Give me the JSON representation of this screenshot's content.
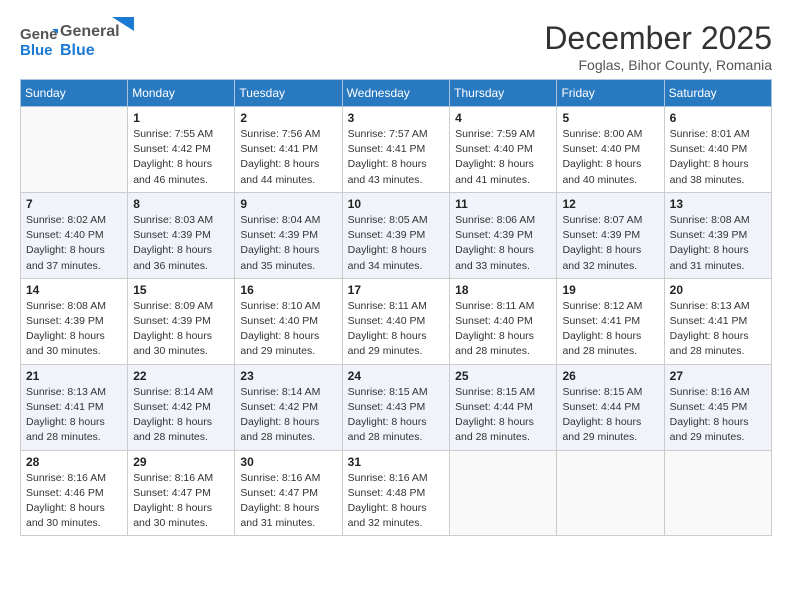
{
  "header": {
    "logo_general": "General",
    "logo_blue": "Blue",
    "month_title": "December 2025",
    "location": "Foglas, Bihor County, Romania"
  },
  "days_of_week": [
    "Sunday",
    "Monday",
    "Tuesday",
    "Wednesday",
    "Thursday",
    "Friday",
    "Saturday"
  ],
  "weeks": [
    [
      {
        "day": "",
        "info": ""
      },
      {
        "day": "1",
        "info": "Sunrise: 7:55 AM\nSunset: 4:42 PM\nDaylight: 8 hours\nand 46 minutes."
      },
      {
        "day": "2",
        "info": "Sunrise: 7:56 AM\nSunset: 4:41 PM\nDaylight: 8 hours\nand 44 minutes."
      },
      {
        "day": "3",
        "info": "Sunrise: 7:57 AM\nSunset: 4:41 PM\nDaylight: 8 hours\nand 43 minutes."
      },
      {
        "day": "4",
        "info": "Sunrise: 7:59 AM\nSunset: 4:40 PM\nDaylight: 8 hours\nand 41 minutes."
      },
      {
        "day": "5",
        "info": "Sunrise: 8:00 AM\nSunset: 4:40 PM\nDaylight: 8 hours\nand 40 minutes."
      },
      {
        "day": "6",
        "info": "Sunrise: 8:01 AM\nSunset: 4:40 PM\nDaylight: 8 hours\nand 38 minutes."
      }
    ],
    [
      {
        "day": "7",
        "info": "Sunrise: 8:02 AM\nSunset: 4:40 PM\nDaylight: 8 hours\nand 37 minutes."
      },
      {
        "day": "8",
        "info": "Sunrise: 8:03 AM\nSunset: 4:39 PM\nDaylight: 8 hours\nand 36 minutes."
      },
      {
        "day": "9",
        "info": "Sunrise: 8:04 AM\nSunset: 4:39 PM\nDaylight: 8 hours\nand 35 minutes."
      },
      {
        "day": "10",
        "info": "Sunrise: 8:05 AM\nSunset: 4:39 PM\nDaylight: 8 hours\nand 34 minutes."
      },
      {
        "day": "11",
        "info": "Sunrise: 8:06 AM\nSunset: 4:39 PM\nDaylight: 8 hours\nand 33 minutes."
      },
      {
        "day": "12",
        "info": "Sunrise: 8:07 AM\nSunset: 4:39 PM\nDaylight: 8 hours\nand 32 minutes."
      },
      {
        "day": "13",
        "info": "Sunrise: 8:08 AM\nSunset: 4:39 PM\nDaylight: 8 hours\nand 31 minutes."
      }
    ],
    [
      {
        "day": "14",
        "info": "Sunrise: 8:08 AM\nSunset: 4:39 PM\nDaylight: 8 hours\nand 30 minutes."
      },
      {
        "day": "15",
        "info": "Sunrise: 8:09 AM\nSunset: 4:39 PM\nDaylight: 8 hours\nand 30 minutes."
      },
      {
        "day": "16",
        "info": "Sunrise: 8:10 AM\nSunset: 4:40 PM\nDaylight: 8 hours\nand 29 minutes."
      },
      {
        "day": "17",
        "info": "Sunrise: 8:11 AM\nSunset: 4:40 PM\nDaylight: 8 hours\nand 29 minutes."
      },
      {
        "day": "18",
        "info": "Sunrise: 8:11 AM\nSunset: 4:40 PM\nDaylight: 8 hours\nand 28 minutes."
      },
      {
        "day": "19",
        "info": "Sunrise: 8:12 AM\nSunset: 4:41 PM\nDaylight: 8 hours\nand 28 minutes."
      },
      {
        "day": "20",
        "info": "Sunrise: 8:13 AM\nSunset: 4:41 PM\nDaylight: 8 hours\nand 28 minutes."
      }
    ],
    [
      {
        "day": "21",
        "info": "Sunrise: 8:13 AM\nSunset: 4:41 PM\nDaylight: 8 hours\nand 28 minutes."
      },
      {
        "day": "22",
        "info": "Sunrise: 8:14 AM\nSunset: 4:42 PM\nDaylight: 8 hours\nand 28 minutes."
      },
      {
        "day": "23",
        "info": "Sunrise: 8:14 AM\nSunset: 4:42 PM\nDaylight: 8 hours\nand 28 minutes."
      },
      {
        "day": "24",
        "info": "Sunrise: 8:15 AM\nSunset: 4:43 PM\nDaylight: 8 hours\nand 28 minutes."
      },
      {
        "day": "25",
        "info": "Sunrise: 8:15 AM\nSunset: 4:44 PM\nDaylight: 8 hours\nand 28 minutes."
      },
      {
        "day": "26",
        "info": "Sunrise: 8:15 AM\nSunset: 4:44 PM\nDaylight: 8 hours\nand 29 minutes."
      },
      {
        "day": "27",
        "info": "Sunrise: 8:16 AM\nSunset: 4:45 PM\nDaylight: 8 hours\nand 29 minutes."
      }
    ],
    [
      {
        "day": "28",
        "info": "Sunrise: 8:16 AM\nSunset: 4:46 PM\nDaylight: 8 hours\nand 30 minutes."
      },
      {
        "day": "29",
        "info": "Sunrise: 8:16 AM\nSunset: 4:47 PM\nDaylight: 8 hours\nand 30 minutes."
      },
      {
        "day": "30",
        "info": "Sunrise: 8:16 AM\nSunset: 4:47 PM\nDaylight: 8 hours\nand 31 minutes."
      },
      {
        "day": "31",
        "info": "Sunrise: 8:16 AM\nSunset: 4:48 PM\nDaylight: 8 hours\nand 32 minutes."
      },
      {
        "day": "",
        "info": ""
      },
      {
        "day": "",
        "info": ""
      },
      {
        "day": "",
        "info": ""
      }
    ]
  ]
}
